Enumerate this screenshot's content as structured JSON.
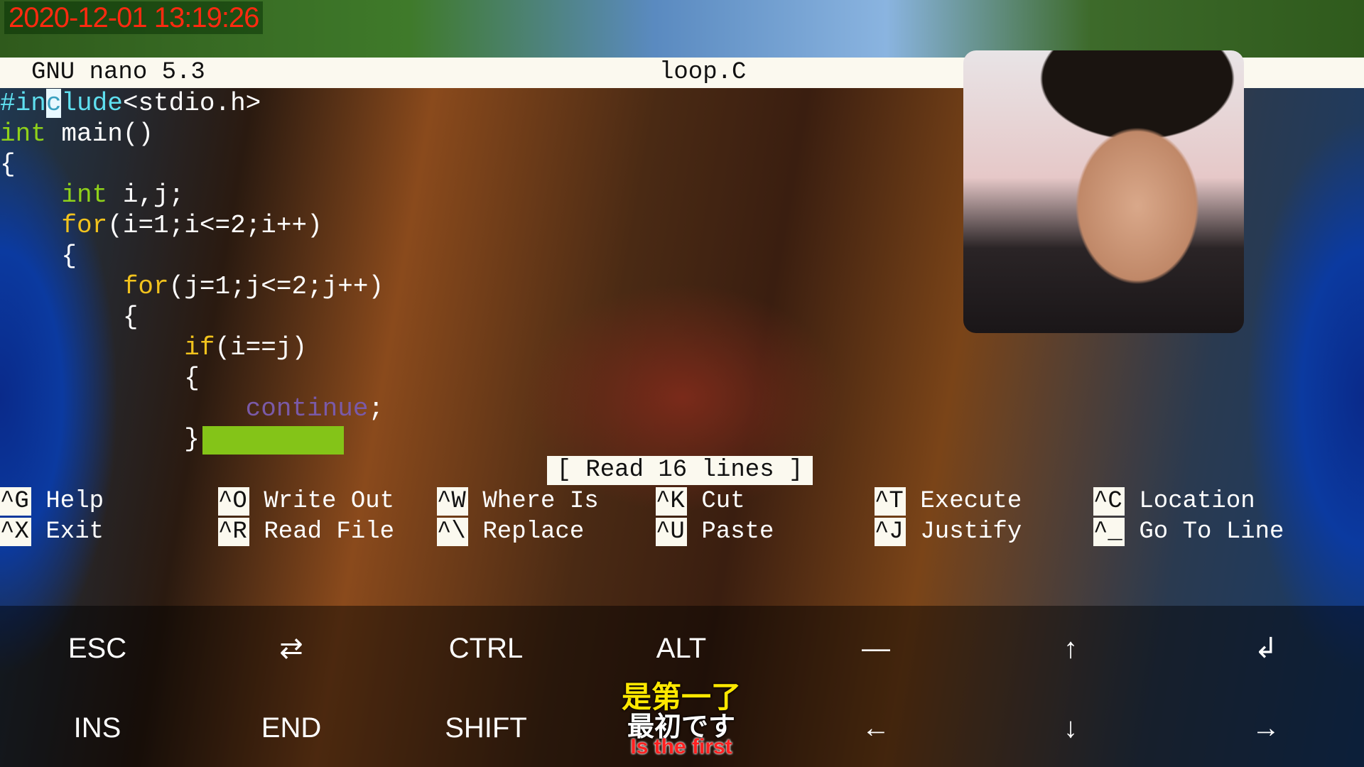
{
  "overlay": {
    "timestamp": "2020-12-01 13:19:26"
  },
  "titlebar": {
    "app": "GNU nano 5.3",
    "filename": "loop.C"
  },
  "code": [
    [
      {
        "t": "#in",
        "c": "pp"
      },
      {
        "t": "c",
        "c": "cursor"
      },
      {
        "t": "lude",
        "c": "pp"
      },
      {
        "t": "<stdio.h>",
        "c": ""
      }
    ],
    [
      {
        "t": "int",
        "c": "kw-g"
      },
      {
        "t": " main()",
        "c": ""
      }
    ],
    [
      {
        "t": "{",
        "c": ""
      }
    ],
    [
      {
        "t": "    ",
        "c": ""
      },
      {
        "t": "int",
        "c": "kw-g"
      },
      {
        "t": " i,j;",
        "c": ""
      }
    ],
    [
      {
        "t": "    ",
        "c": ""
      },
      {
        "t": "for",
        "c": "kw-y"
      },
      {
        "t": "(i=1;i<=2;i++)",
        "c": ""
      }
    ],
    [
      {
        "t": "    {",
        "c": ""
      }
    ],
    [
      {
        "t": "        ",
        "c": ""
      },
      {
        "t": "for",
        "c": "kw-y"
      },
      {
        "t": "(j=1;j<=2;j++)",
        "c": ""
      }
    ],
    [
      {
        "t": "        {",
        "c": ""
      }
    ],
    [
      {
        "t": "            ",
        "c": ""
      },
      {
        "t": "if",
        "c": "kw-y"
      },
      {
        "t": "(i==j)",
        "c": ""
      }
    ],
    [
      {
        "t": "            {",
        "c": ""
      }
    ],
    [
      {
        "t": "                ",
        "c": ""
      },
      {
        "t": "continue",
        "c": "cm"
      },
      {
        "t": ";",
        "c": ""
      }
    ],
    [
      {
        "t": "            }",
        "c": ""
      }
    ]
  ],
  "status": "[ Read 16 lines ]",
  "shortcuts": [
    {
      "key": "^G",
      "label": "Help"
    },
    {
      "key": "^X",
      "label": "Exit"
    },
    {
      "key": "^O",
      "label": "Write Out"
    },
    {
      "key": "^R",
      "label": "Read File"
    },
    {
      "key": "^W",
      "label": "Where Is"
    },
    {
      "key": "^\\",
      "label": "Replace"
    },
    {
      "key": "^K",
      "label": "Cut"
    },
    {
      "key": "^U",
      "label": "Paste"
    },
    {
      "key": "^T",
      "label": "Execute"
    },
    {
      "key": "^J",
      "label": "Justify"
    },
    {
      "key": "^C",
      "label": "Location"
    },
    {
      "key": "^_",
      "label": "Go To Line"
    }
  ],
  "extra_keys": {
    "row1": [
      "ESC",
      "⇄",
      "CTRL",
      "ALT",
      "—",
      "↑",
      "↲"
    ],
    "row2": [
      "INS",
      "END",
      "SHIFT",
      "",
      "←",
      "↓",
      "→"
    ]
  },
  "subtitles": {
    "chinese": "是第一了",
    "japanese": "最初です",
    "english": "Is the first"
  }
}
